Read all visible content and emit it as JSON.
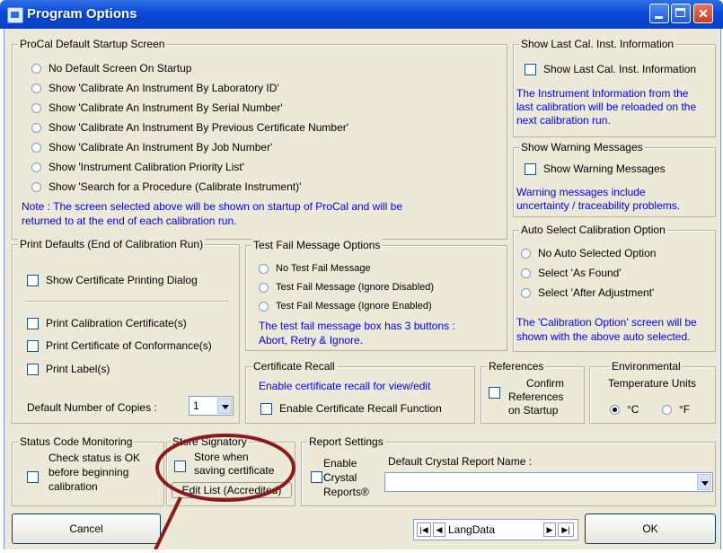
{
  "window": {
    "title": "Program Options"
  },
  "startup": {
    "caption": "ProCal Default Startup Screen",
    "options": [
      "No Default Screen On Startup",
      "Show 'Calibrate An Instrument By Laboratory ID'",
      "Show 'Calibrate An Instrument By Serial Number'",
      "Show 'Calibrate An Instrument By Previous Certificate Number'",
      "Show 'Calibrate An Instrument By Job Number'",
      "Show 'Instrument Calibration Priority List'",
      "Show 'Search for a Procedure (Calibrate Instrument)'"
    ],
    "note1": "Note : The screen selected above will be shown on startup of ProCal and will be",
    "note2": "returned to at the end of each calibration run."
  },
  "last_cal": {
    "caption": "Show Last Cal. Inst. Information",
    "checkbox": "Show Last Cal. Inst. Information",
    "desc1": "The Instrument Information from the",
    "desc2": "last calibration will be reloaded on the",
    "desc3": "next calibration run."
  },
  "warnings": {
    "caption": "Show Warning Messages",
    "checkbox": "Show Warning Messages",
    "desc1": "Warning messages include",
    "desc2": "uncertainty / traceability problems."
  },
  "auto_select": {
    "caption": "Auto Select Calibration Option",
    "options": [
      "No Auto Selected Option",
      "Select 'As Found'",
      "Select 'After Adjustment'"
    ],
    "desc1": "The 'Calibration Option' screen will be",
    "desc2": "shown with the above auto selected."
  },
  "print_defaults": {
    "caption": "Print Defaults (End of Calibration Run)",
    "show_dialog": "Show Certificate Printing Dialog",
    "print_cert": "Print Calibration Certificate(s)",
    "print_conf": "Print Certificate of Conformance(s)",
    "print_label": "Print Label(s)",
    "copies_label": "Default Number of Copies :",
    "copies_value": "1"
  },
  "test_fail": {
    "caption": "Test Fail Message Options",
    "options": [
      "No Test Fail Message",
      "Test Fail Message (Ignore Disabled)",
      "Test Fail Message (Ignore Enabled)"
    ],
    "desc1": "The test fail message box has 3 buttons :",
    "desc2": "Abort, Retry & Ignore."
  },
  "recall": {
    "caption": "Certificate Recall",
    "desc": "Enable certificate recall for view/edit",
    "checkbox": "Enable Certificate Recall Function"
  },
  "references": {
    "caption": "References",
    "line1": "Confirm",
    "line2": "References",
    "line3": "on Startup"
  },
  "environment": {
    "caption1": "Environmental",
    "caption2": "Temperature Units",
    "celsius": "°C",
    "fahrenheit": "°F"
  },
  "status_code": {
    "caption": "Status Code Monitoring",
    "line1": "Check status is OK",
    "line2": "before beginning",
    "line3": "calibration"
  },
  "signatory": {
    "caption": "Store Signatory",
    "line1": "Store when",
    "line2": "saving certificate",
    "edit_button": "Edit List (Accredited)"
  },
  "report": {
    "caption": "Report Settings",
    "line1": "Enable",
    "line2": "Crystal",
    "line3": "Reports®",
    "name_label": "Default Crystal Report Name :",
    "name_value": ""
  },
  "footer": {
    "cancel": "Cancel",
    "ok": "OK",
    "nav_value": "LangData"
  },
  "colors": {
    "accent_blue": "#0000ff",
    "annotation": "#8b1a1a",
    "titlebar": "#0a49d6"
  }
}
